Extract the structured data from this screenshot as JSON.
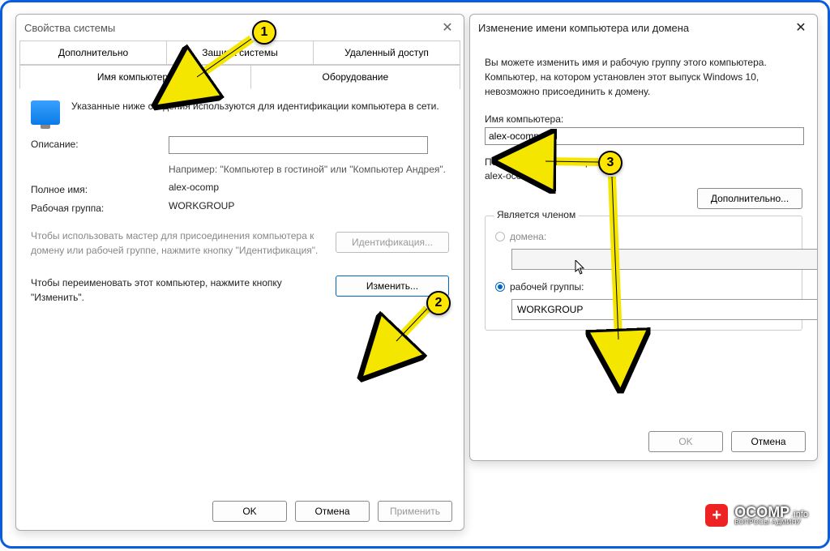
{
  "leftDialog": {
    "title": "Свойства системы",
    "tabs": {
      "row1": [
        "Дополнительно",
        "Защита системы",
        "Удаленный доступ"
      ],
      "row2": [
        "Имя компьютера",
        "Оборудование"
      ],
      "active": "Имя компьютера"
    },
    "introText": "Указанные ниже сведения используются для идентификации компьютера в сети.",
    "descriptionLabel": "Описание:",
    "descriptionValue": "",
    "descriptionHint": "Например: \"Компьютер в гостиной\" или \"Компьютер Андрея\".",
    "fullNameLabel": "Полное имя:",
    "fullNameValue": "alex-ocomp",
    "workgroupLabel": "Рабочая группа:",
    "workgroupValue": "WORKGROUP",
    "wizardText": "Чтобы использовать мастер для присоединения компьютера к домену или рабочей группе, нажмите кнопку \"Идентификация\".",
    "identifyButton": "Идентификация...",
    "renameText": "Чтобы переименовать этот компьютер, нажмите кнопку \"Изменить\".",
    "changeButton": "Изменить...",
    "okButton": "OK",
    "cancelButton": "Отмена",
    "applyButton": "Применить"
  },
  "rightDialog": {
    "title": "Изменение имени компьютера или домена",
    "introText": "Вы можете изменить имя и рабочую группу этого компьютера. Компьютер, на котором установлен этот выпуск Windows 10, невозможно присоединить к домену.",
    "nameLabel": "Имя компьютера:",
    "nameValue": "alex-ocomp",
    "fullNameLabel": "Полное имя компьютера:",
    "fullNameValue": "alex-ocomp",
    "advancedButton": "Дополнительно...",
    "memberLegend": "Является членом",
    "domainLabel": "домена:",
    "domainValue": "",
    "workgroupLabel": "рабочей группы:",
    "workgroupValue": "WORKGROUP",
    "okButton": "OK",
    "cancelButton": "Отмена"
  },
  "markers": {
    "m1": "1",
    "m2": "2",
    "m3": "3"
  },
  "watermark": {
    "badge": "+",
    "name": "OCOMP",
    "suffix": ".info",
    "sub": "ВОПРОСЫ АДМИНУ"
  }
}
